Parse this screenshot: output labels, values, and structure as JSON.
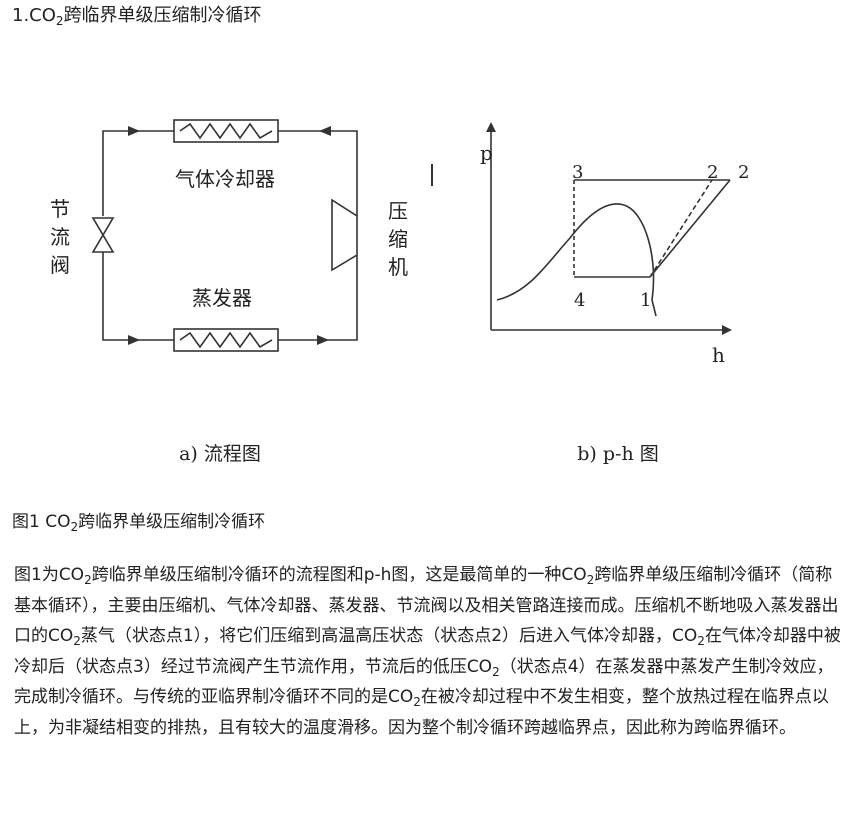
{
  "heading": {
    "prefix": "1.CO",
    "sub": "2",
    "suffix": "跨临界单级压缩制冷循环"
  },
  "figure": {
    "flow": {
      "gas_cooler": "气体冷却器",
      "evaporator": "蒸发器",
      "valve_chars": [
        "节",
        "流",
        "阀"
      ],
      "compressor_chars": [
        "压",
        "缩",
        "机"
      ],
      "label": "a)  流程图"
    },
    "ph": {
      "p_label": "p",
      "h_label": "h",
      "point_3": "3",
      "point_2a": "2",
      "point_2b": "2",
      "point_4": "4",
      "point_1": "1",
      "label": "b) p-h 图"
    }
  },
  "caption": {
    "prefix": "图1 CO",
    "sub": "2",
    "suffix": "跨临界单级压缩制冷循环"
  },
  "paragraph": {
    "s1": "图1为CO",
    "sub1": "2",
    "s2": "跨临界单级压缩制冷循环的流程图和p-h图，这是最简单的一种CO",
    "sub2": "2",
    "s3": "跨临界单级压缩制冷循环（简称基本循环），主要由压缩机、气体冷却器、蒸发器、节流阀以及相关管路连接而成。压缩机不断地吸入蒸发器出口的CO",
    "sub3": "2",
    "s4": "蒸气（状态点1），将它们压缩到高温高压状态（状态点2）后进入气体冷却器，CO",
    "sub4": "2",
    "s5": "在气体冷却器中被冷却后（状态点3）经过节流阀产生节流作用，节流后的低压CO",
    "sub5": "2",
    "s6": "（状态点4）在蒸发器中蒸发产生制冷效应，完成制冷循环。与传统的亚临界制冷循环不同的是CO",
    "sub6": "2",
    "s7": "在被冷却过程中不发生相变，整个放热过程在临界点以上，为非凝结相变的排热，且有较大的温度滑移。因为整个制冷循环跨越临界点，因此称为跨临界循环。"
  }
}
